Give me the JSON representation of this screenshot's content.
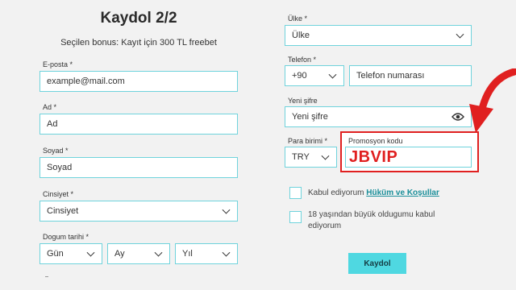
{
  "header": {
    "title": "Kaydol 2/2",
    "bonus_text": "Seçilen bonus: Kayıt için 300 TL freebet"
  },
  "left": {
    "email": {
      "label": "E-posta *",
      "placeholder": "example@mail.com"
    },
    "first_name": {
      "label": "Ad *",
      "placeholder": "Ad"
    },
    "last_name": {
      "label": "Soyad *",
      "placeholder": "Soyad"
    },
    "gender": {
      "label": "Cinsiyet *",
      "value": "Cinsiyet"
    },
    "birth_date": {
      "label": "Dogum tarihi *",
      "day": "Gün",
      "month": "Ay",
      "year": "Yıl"
    }
  },
  "right": {
    "country": {
      "label": "Ülke *",
      "value": "Ülke"
    },
    "phone": {
      "label": "Telefon *",
      "code": "+90",
      "placeholder": "Telefon numarası"
    },
    "password": {
      "label": "Yeni şifre",
      "placeholder": "Yeni şifre"
    },
    "currency": {
      "label": "Para birimi *",
      "value": "TRY"
    },
    "promo": {
      "label": "Promosyon kodu",
      "value": "JBVIP"
    },
    "terms": {
      "prefix": "Kabul ediyorum ",
      "link": "Hüküm ve Koşullar"
    },
    "age": {
      "line1": "18 yaşından büyük oldugumu kabul",
      "line2": "ediyorum"
    },
    "submit_label": "Kaydol"
  },
  "colors": {
    "accent": "#4fd8e1",
    "field_border": "#6fd3dc",
    "annotation_red": "#e02020",
    "background": "#f2f2f2"
  }
}
